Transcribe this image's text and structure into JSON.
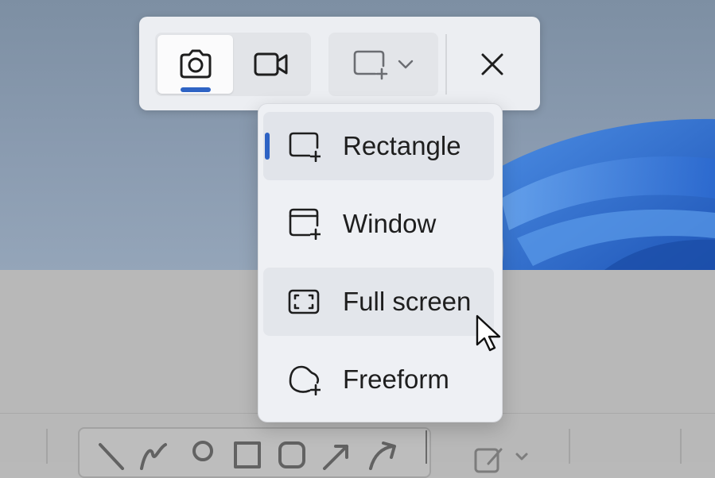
{
  "snip_toolbar": {
    "modes": [
      {
        "icon": "camera-icon",
        "selected": true
      },
      {
        "icon": "video-camera-icon",
        "selected": false
      }
    ],
    "shape_dropdown_icon": "rectangle-snip-icon",
    "dropdown_arrow_icon": "chevron-down-icon",
    "close_icon": "close-icon"
  },
  "snip_menu": {
    "items": [
      {
        "label": "Rectangle",
        "icon": "rectangle-snip-icon",
        "selected": true
      },
      {
        "label": "Window",
        "icon": "window-snip-icon",
        "selected": false
      },
      {
        "label": "Full screen",
        "icon": "full-screen-snip-icon",
        "selected": false,
        "hovered": true
      },
      {
        "label": "Freeform",
        "icon": "freeform-snip-icon",
        "selected": false
      }
    ]
  },
  "colors": {
    "accent": "#2e63c4",
    "toolbar_bg": "#eceef2",
    "desktop_top": "#7d8fa3",
    "wallpaper_bloom": "#2f6fd0"
  }
}
